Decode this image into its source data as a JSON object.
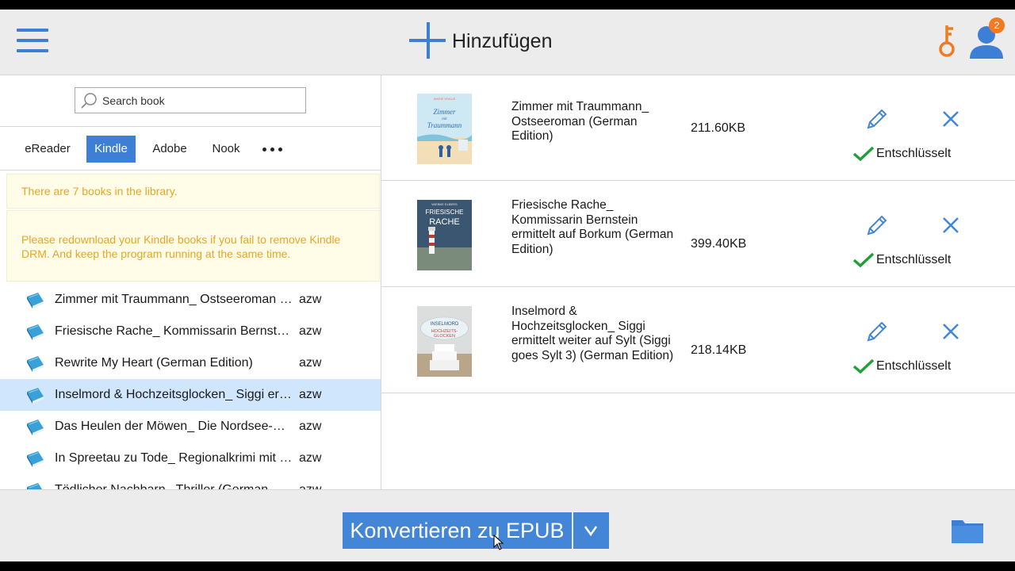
{
  "topbar": {
    "add_label": "Hinzufügen",
    "notification_count": "2",
    "accent_color": "#3e7fd6",
    "key_color": "#f07b22"
  },
  "search": {
    "placeholder": "Search book"
  },
  "tabs": [
    {
      "label": "eReader",
      "active": false
    },
    {
      "label": "Kindle",
      "active": true
    },
    {
      "label": "Adobe",
      "active": false
    },
    {
      "label": "Nook",
      "active": false
    }
  ],
  "notices": {
    "count": "There are 7 books in the library.",
    "redownload": "Please redownload your Kindle books if you fail to remove Kindle DRM. And keep the program running at the same time."
  },
  "books": [
    {
      "name": "Zimmer mit Traummann_ Ostseeroman (German Edition)",
      "format": "azw",
      "selected": false
    },
    {
      "name": "Friesische Rache_ Kommissarin Bernstein ermittelt auf Borkum (German Edition)",
      "format": "azw",
      "selected": false
    },
    {
      "name": "Rewrite My Heart (German Edition)",
      "format": "azw",
      "selected": false
    },
    {
      "name": "Inselmord & Hochzeitsglocken_ Siggi ermittelt weiter auf Sylt",
      "format": "azw",
      "selected": true
    },
    {
      "name": "Das Heulen der Möwen_ Die Nordsee-Krimi",
      "format": "azw",
      "selected": false
    },
    {
      "name": "In Spreetau zu Tode_ Regionalkrimi mit Herz",
      "format": "azw",
      "selected": false
    },
    {
      "name": "Tödlicher Nachbarn_ Thriller (German Edition)",
      "format": "azw",
      "selected": false
    }
  ],
  "converted": [
    {
      "title": "Zimmer mit Traummann_ Ostseeroman (German Edition)",
      "size": "211.60KB",
      "status": "Entschlüsselt",
      "cover_title": "Zimmer mit Traummann",
      "cover_author": "MARIE KRAUS"
    },
    {
      "title": "Friesische Rache_ Kommissarin Bernstein ermittelt auf Borkum (German Edition)",
      "size": "399.40KB",
      "status": "Entschlüsselt",
      "cover_title": "FRIESISCHE RACHE",
      "cover_author": "WIEBKE ELBERS"
    },
    {
      "title": "Inselmord & Hochzeitsglocken_ Siggi ermittelt weiter auf Sylt (Siggi goes Sylt 3) (German Edition)",
      "size": "218.14KB",
      "status": "Entschlüsselt",
      "cover_title": "INSELMORD & HOCHZEITSGLOCKEN",
      "cover_author": ""
    }
  ],
  "bottombar": {
    "convert_label": "Konvertieren zu EPUB"
  }
}
